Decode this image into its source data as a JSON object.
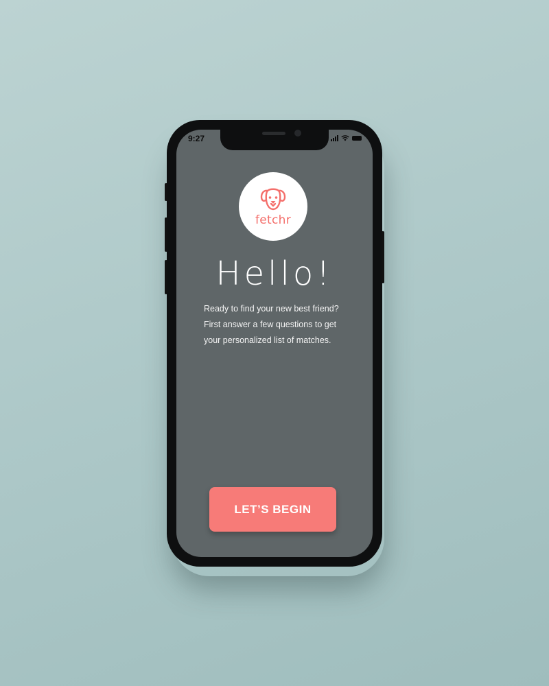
{
  "status_bar": {
    "time": "9:27",
    "icons": [
      "signal-icon",
      "wifi-icon",
      "battery-icon"
    ]
  },
  "logo": {
    "icon": "dog-icon",
    "text": "fetchr"
  },
  "welcome": {
    "title": "Hello!",
    "lines": [
      "Ready to find your new best friend?",
      "First answer a few questions to get",
      "your personalized list of matches."
    ]
  },
  "cta": {
    "label": "LET’S BEGIN"
  },
  "colors": {
    "accent": "#f77b78",
    "logo": "#f46f6b",
    "screen": "#5f6668",
    "background": "#adc8c8"
  }
}
